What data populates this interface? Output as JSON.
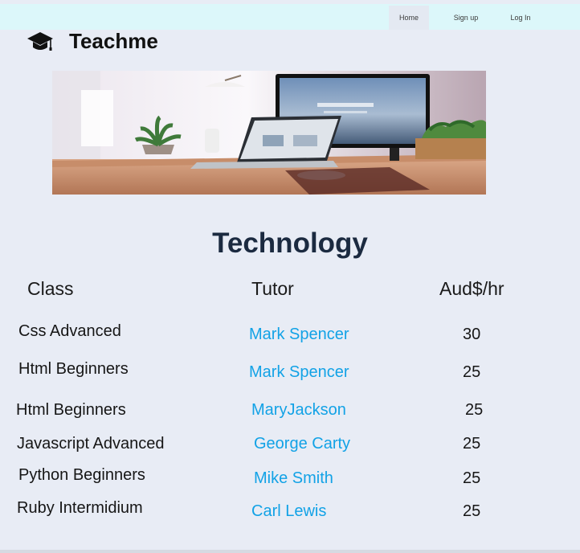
{
  "nav": {
    "items": [
      {
        "label": "Home"
      },
      {
        "label": "Sign up"
      },
      {
        "label": "Log In"
      }
    ]
  },
  "brand": {
    "name": "Teachme",
    "icon": "graduation-cap-icon"
  },
  "hero": {
    "image": "desk-with-computer-and-laptop"
  },
  "section": {
    "title": "Technology"
  },
  "table": {
    "headers": {
      "class": "Class",
      "tutor": "Tutor",
      "rate": "Aud$/hr"
    },
    "rows": [
      {
        "class": "Css Advanced",
        "tutor": "Mark Spencer",
        "rate": "30"
      },
      {
        "class": "Html Beginners",
        "tutor": "Mark Spencer",
        "rate": "25"
      },
      {
        "class": "Html Beginners",
        "tutor": "MaryJackson",
        "rate": "25"
      },
      {
        "class": "Javascript Advanced",
        "tutor": "George Carty",
        "rate": "25"
      },
      {
        "class": "Python Beginners",
        "tutor": "Mike Smith",
        "rate": "25"
      },
      {
        "class": "Ruby Intermidium",
        "tutor": "Carl Lewis",
        "rate": "25"
      }
    ]
  },
  "colors": {
    "link": "#12a2e6",
    "topbar": "#dcf7fa",
    "background": "#e8ecf5",
    "title": "#1b2a40"
  }
}
